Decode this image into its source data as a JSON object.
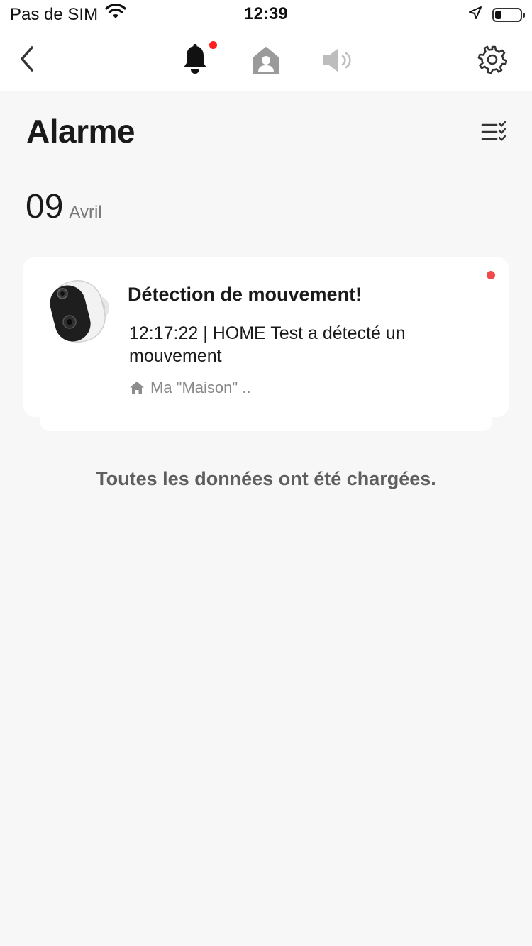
{
  "status_bar": {
    "carrier": "Pas de SIM",
    "time": "12:39",
    "battery_level": 0.25
  },
  "nav": {
    "icons": [
      "back-icon",
      "bell-icon",
      "house-person-icon",
      "speaker-icon",
      "gear-icon"
    ],
    "bell_has_notification": true
  },
  "page": {
    "title": "Alarme",
    "filter_icon": "list-check-icon"
  },
  "date_group": {
    "day": "09",
    "month": "Avril"
  },
  "alarms": [
    {
      "title": "Détection de mouvement!",
      "description": "12:17:22 | HOME Test a détecté un mouvement",
      "location": "Ma \"Maison\" ..",
      "unread": true,
      "thumbnail": "camera-thumbnail"
    }
  ],
  "footer": {
    "loaded_message": "Toutes les données ont été chargées."
  },
  "colors": {
    "accent_red": "#ff1f1f",
    "unread_dot": "#f24a4a",
    "background": "#f7f7f7",
    "muted_text": "#888888"
  }
}
